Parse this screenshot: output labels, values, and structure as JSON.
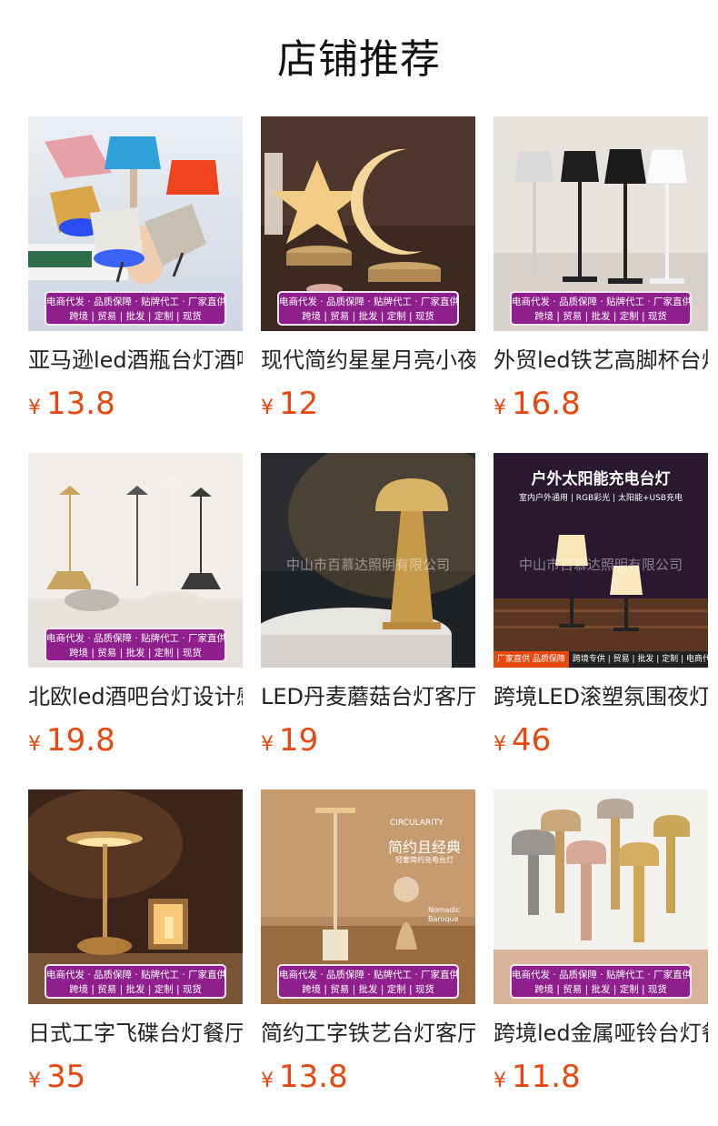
{
  "header": {
    "title": "店铺推荐"
  },
  "banner": {
    "line1": "电商代发 · 品质保障 · 贴牌代工 · 厂家直供",
    "line2": "跨境 | 贸易 | 批发 | 定制 | 现货"
  },
  "watermark": "中山市百慕达照明有限公司",
  "solar": {
    "title": "户外太阳能充电台灯",
    "subtitle": "室内户外通用 | RGB彩光 | 太阳能+USB充电",
    "tag": "厂家直供 品质保障",
    "strip": "跨境专供 | 贸易 | 批发 | 定制 | 电商代发"
  },
  "minimal": {
    "brand": "CIRCULARITY",
    "heading": "简约且经典",
    "sub": "轻奢简约充电台灯",
    "note1": "Nomadic",
    "note2": "Baroque"
  },
  "currency": "¥",
  "products": [
    {
      "name": "亚马逊led酒瓶台灯酒吧餐厅",
      "price": "13.8"
    },
    {
      "name": "现代简约星星月亮小夜灯",
      "price": "12"
    },
    {
      "name": "外贸led铁艺高脚杯台灯",
      "price": "16.8"
    },
    {
      "name": "北欧led酒吧台灯设计感",
      "price": "19.8"
    },
    {
      "name": "LED丹麦蘑菇台灯客厅卧室",
      "price": "19"
    },
    {
      "name": "跨境LED滚塑氛围夜灯户外",
      "price": "46"
    },
    {
      "name": "日式工字飞碟台灯餐厅酒吧",
      "price": "35"
    },
    {
      "name": "简约工字铁艺台灯客厅卧室",
      "price": "13.8"
    },
    {
      "name": "跨境led金属哑铃台灯餐厅",
      "price": "11.8"
    }
  ],
  "colors": {
    "price": "#e8470f",
    "banner": "#8e1f8c"
  }
}
